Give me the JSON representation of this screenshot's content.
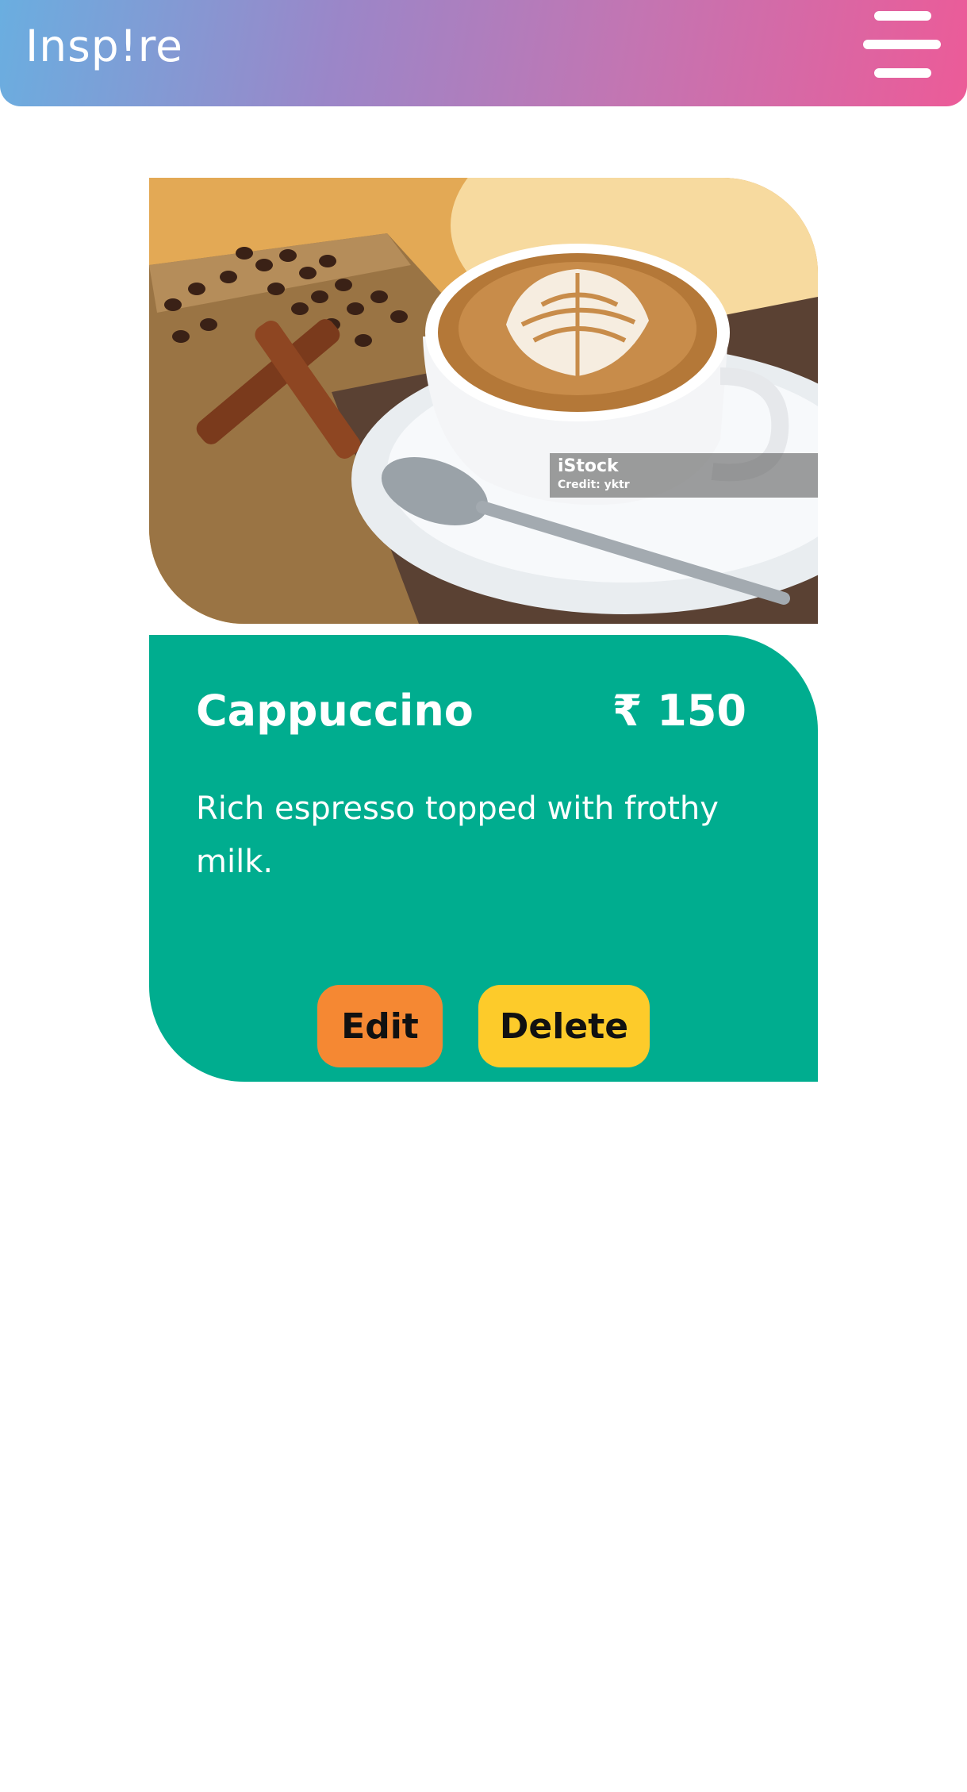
{
  "header": {
    "brand": "Insp!re",
    "menu_icon": "hamburger-menu-icon",
    "gradient_colors": [
      "#6aaee0",
      "#9b86c8",
      "#c375b2",
      "#ec5b98"
    ]
  },
  "card": {
    "image": {
      "subject": "cappuccino-photo",
      "watermark_brand": "iStock",
      "watermark_credit": "Credit: yktr"
    },
    "title": "Cappuccino",
    "price": "₹ 150",
    "description": "Rich espresso topped with frothy milk.",
    "body_color": "#00ad8f",
    "actions": {
      "edit_label": "Edit",
      "edit_color": "#f58833",
      "delete_label": "Delete",
      "delete_color": "#fdcb2a"
    }
  }
}
